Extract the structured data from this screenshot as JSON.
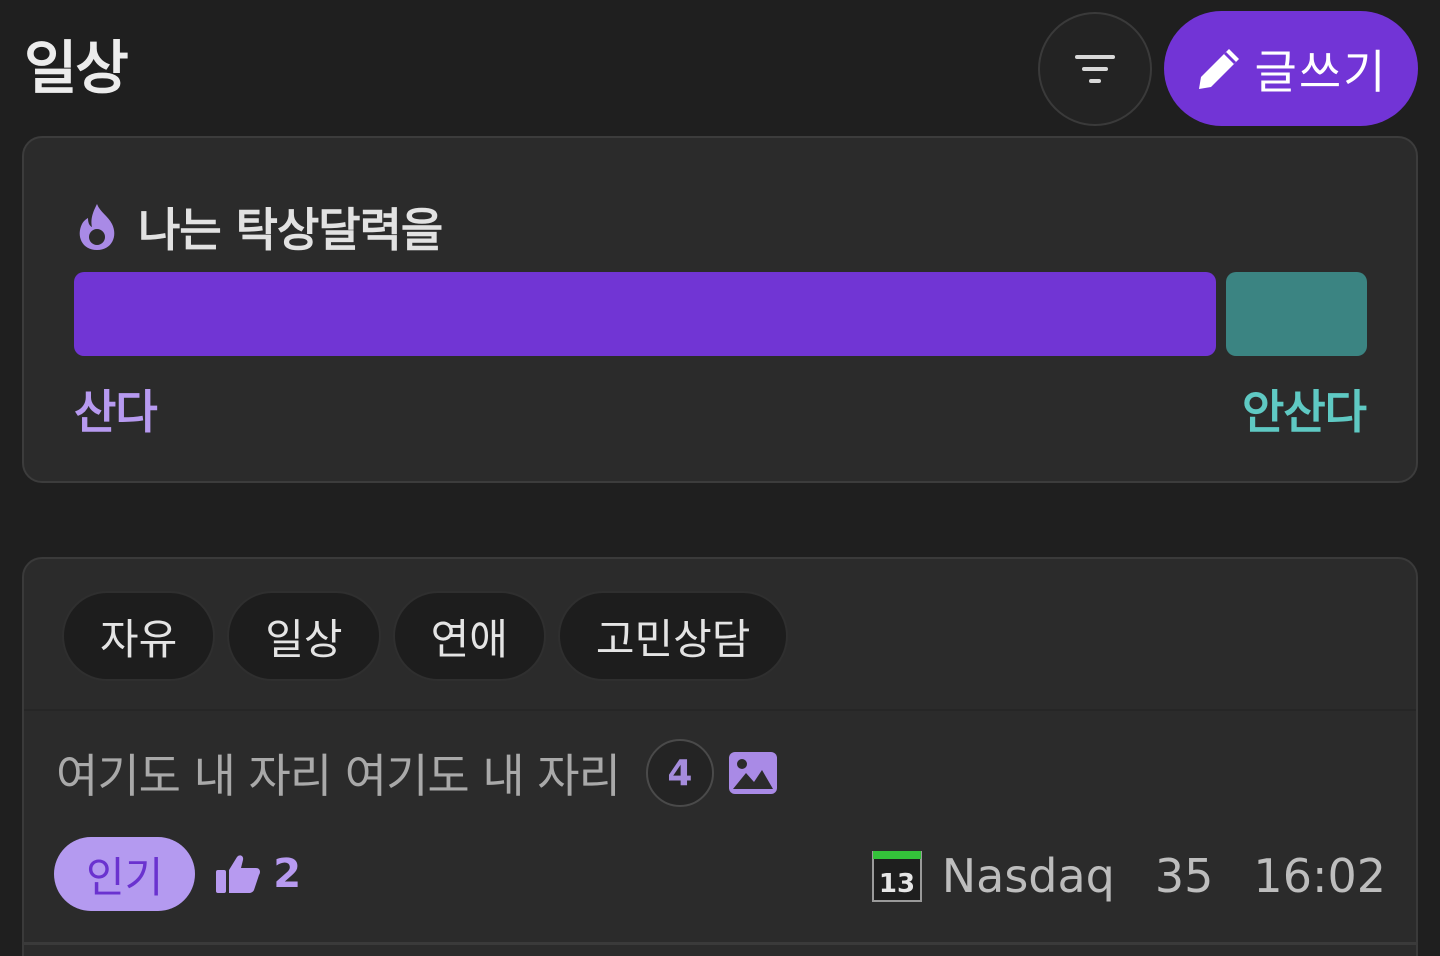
{
  "header": {
    "title": "일상",
    "write_label": "글쓰기"
  },
  "poll": {
    "question": "나는 탁상달력을",
    "option_yes": "산다",
    "option_no": "안산다",
    "yes_ratio": 0.89,
    "colors": {
      "yes": "#7135d4",
      "no": "#3b8482"
    }
  },
  "categories": [
    {
      "label": "자유"
    },
    {
      "label": "일상"
    },
    {
      "label": "연애"
    },
    {
      "label": "고민상담"
    }
  ],
  "post": {
    "title": "여기도 내 자리 여기도 내 자리",
    "comment_count": "4",
    "badge": "인기",
    "likes": "2",
    "calendar_day": "13",
    "author": "Nasdaq",
    "views": "35",
    "time": "16:02"
  },
  "colors": {
    "accent": "#7234d6",
    "background": "#1f1f1f",
    "card": "#2b2b2b"
  }
}
